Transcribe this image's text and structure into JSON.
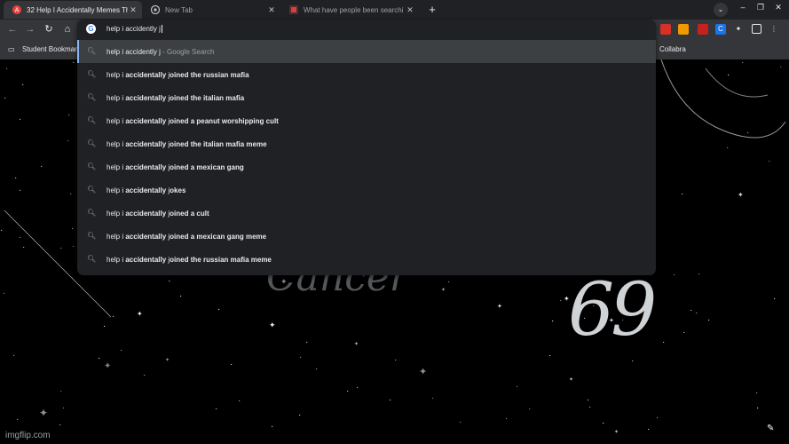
{
  "tabs": [
    {
      "title": "32 Help I Accidentally Memes Th",
      "favicon": "imgflip-icon",
      "active": true
    },
    {
      "title": "New Tab",
      "favicon": "chrome-icon",
      "active": false
    },
    {
      "title": "What have people been searchi",
      "favicon": "imgflip-logo-icon",
      "active": false
    }
  ],
  "omnibox": {
    "value": "help i accidently j",
    "selected_suggestion": {
      "typed": "help i accidently j",
      "suffix": " - Google Search"
    },
    "suggestions": [
      {
        "prefix": "help i ",
        "bold": "accidentally",
        "mid": " j",
        "rest": "oined the russian mafia"
      },
      {
        "prefix": "help i ",
        "bold": "accidentally",
        "mid": " j",
        "rest": "oined the italian mafia"
      },
      {
        "prefix": "help i ",
        "bold": "accidentally",
        "mid": " j",
        "rest": "oined a peanut worshipping cult"
      },
      {
        "prefix": "help i ",
        "bold": "accidentally",
        "mid": " j",
        "rest": "oined the italian mafia meme"
      },
      {
        "prefix": "help i ",
        "bold": "accidentally",
        "mid": " j",
        "rest": "oined a mexican gang"
      },
      {
        "prefix": "help i ",
        "bold": "accidentally",
        "mid": " j",
        "rest": "okes"
      },
      {
        "prefix": "help i ",
        "bold": "accidentally",
        "mid": " j",
        "rest": "oined a cult"
      },
      {
        "prefix": "help i ",
        "bold": "accidentally",
        "mid": " j",
        "rest": "oined a mexican gang meme"
      },
      {
        "prefix": "help i ",
        "bold": "accidentally",
        "mid": " j",
        "rest": "oined the russian mafia meme"
      }
    ]
  },
  "bookmarks": {
    "left": "Student Bookmar",
    "right": "Collabra"
  },
  "page": {
    "ghost_text": "Cancer",
    "sign_text": "69",
    "watermark": "imgflip.com"
  },
  "colors": {
    "accent": "#8ab4f8",
    "tabbar": "#202124",
    "toolbar": "#35363a"
  }
}
